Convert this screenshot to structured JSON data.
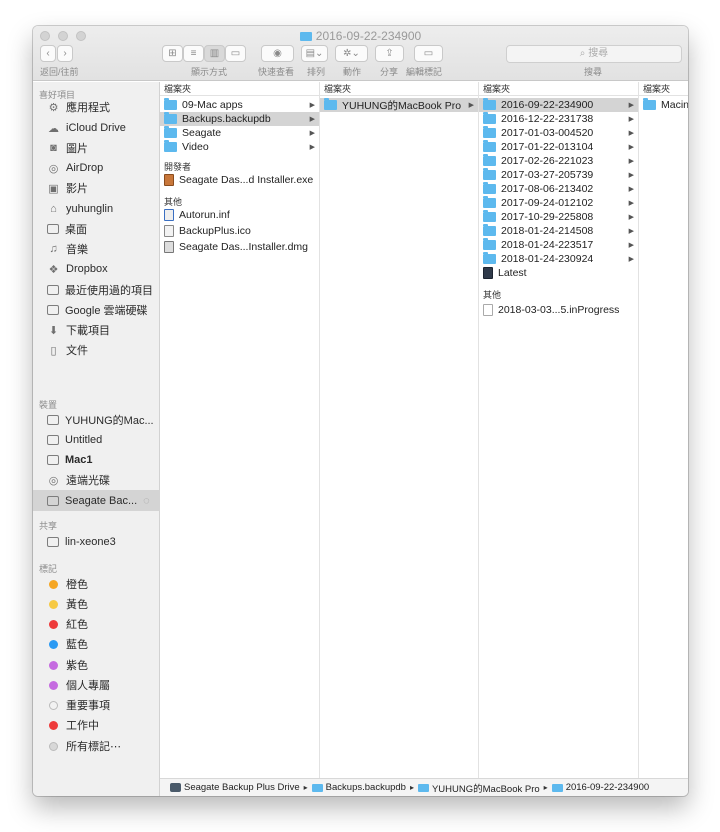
{
  "window": {
    "title": "2016-09-22-234900"
  },
  "toolbar": {
    "back_forward_label": "返回/往前",
    "view_label": "顯示方式",
    "quicklook_label": "快速查看",
    "arrange_label": "排列",
    "action_label": "動作",
    "share_label": "分享",
    "tags_label": "編輯標記",
    "search_label": "搜尋",
    "search_placeholder": "搜尋"
  },
  "sidebar": {
    "favorites_header": "喜好項目",
    "favorites": [
      {
        "label": "應用程式",
        "icon": "apps-icon"
      },
      {
        "label": "iCloud Drive",
        "icon": "cloud-icon"
      },
      {
        "label": "圖片",
        "icon": "camera-icon"
      },
      {
        "label": "AirDrop",
        "icon": "airdrop-icon"
      },
      {
        "label": "影片",
        "icon": "film-icon"
      },
      {
        "label": "yuhunglin",
        "icon": "home-icon"
      },
      {
        "label": "桌面",
        "icon": "desktop-icon"
      },
      {
        "label": "音樂",
        "icon": "music-icon"
      },
      {
        "label": "Dropbox",
        "icon": "dropbox-icon"
      },
      {
        "label": "最近使用過的項目",
        "icon": "recents-icon"
      },
      {
        "label": "Google 雲端硬碟",
        "icon": "folder-icon"
      },
      {
        "label": "下載項目",
        "icon": "download-icon"
      },
      {
        "label": "文件",
        "icon": "documents-icon"
      }
    ],
    "devices_header": "裝置",
    "devices": [
      {
        "label": "YUHUNG的Mac...",
        "icon": "laptop-icon"
      },
      {
        "label": "Untitled",
        "icon": "disk-icon"
      },
      {
        "label": "Mac1",
        "icon": "disk-icon"
      },
      {
        "label": "遠端光碟",
        "icon": "optical-disc-icon"
      },
      {
        "label": "Seagate Bac...",
        "icon": "external-drive-icon"
      }
    ],
    "shared_header": "共享",
    "shared": [
      {
        "label": "lin-xeone3",
        "icon": "monitor-icon"
      }
    ],
    "tags_header": "標記",
    "tags": [
      {
        "label": "橙色",
        "color": "#f5a623"
      },
      {
        "label": "黃色",
        "color": "#f6c944"
      },
      {
        "label": "紅色",
        "color": "#ee3b3b"
      },
      {
        "label": "藍色",
        "color": "#2b9af3"
      },
      {
        "label": "紫色",
        "color": "#c56be0"
      },
      {
        "label": "個人專屬",
        "color": "#c56be0"
      },
      {
        "label": "重要事項",
        "color": "#e6e6e6"
      },
      {
        "label": "工作中",
        "color": "#ee3b3b"
      },
      {
        "label": "所有標記⋯",
        "color": "#d8d8d8"
      }
    ]
  },
  "columns": {
    "header": "檔案夾",
    "col1": {
      "folders": [
        "09-Mac apps",
        "Backups.backupdb",
        "Seagate",
        "Video"
      ],
      "developer_header": "開發者",
      "developer": [
        "Seagate Das...d Installer.exe"
      ],
      "other_header": "其他",
      "other": [
        "Autorun.inf",
        "BackupPlus.ico",
        "Seagate Das...Installer.dmg"
      ]
    },
    "col2": {
      "folders": [
        "YUHUNG的MacBook Pro"
      ]
    },
    "col3": {
      "folders": [
        "2016-09-22-234900",
        "2016-12-22-231738",
        "2017-01-03-004520",
        "2017-01-22-013104",
        "2017-02-26-221023",
        "2017-03-27-205739",
        "2017-08-06-213402",
        "2017-09-24-012102",
        "2017-10-29-225808",
        "2018-01-24-214508",
        "2018-01-24-223517",
        "2018-01-24-230924"
      ],
      "latest": "Latest",
      "other_header": "其他",
      "other": [
        "2018-03-03...5.inProgress"
      ]
    },
    "col4": {
      "folders": [
        "Macin"
      ]
    }
  },
  "pathbar": {
    "items": [
      "Seagate Backup Plus Drive",
      "Backups.backupdb",
      "YUHUNG的MacBook Pro",
      "2016-09-22-234900"
    ]
  }
}
